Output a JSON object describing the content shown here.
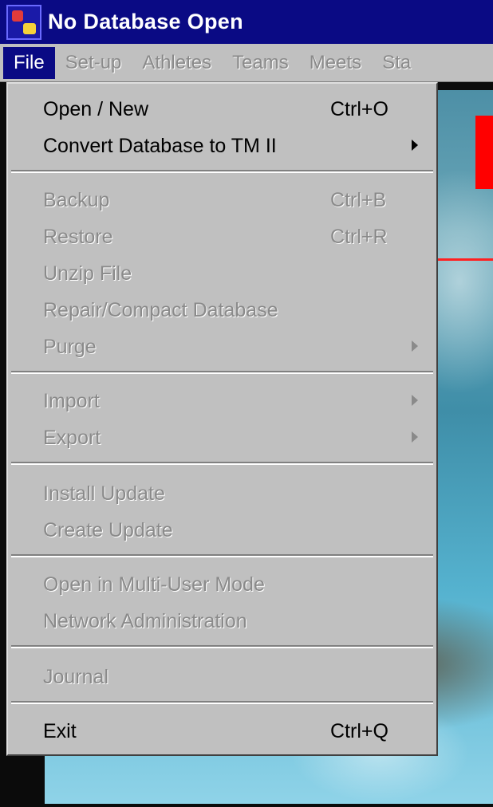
{
  "window": {
    "title": "No Database Open"
  },
  "menubar": {
    "items": [
      {
        "label": "File"
      },
      {
        "label": "Set-up"
      },
      {
        "label": "Athletes"
      },
      {
        "label": "Teams"
      },
      {
        "label": "Meets"
      },
      {
        "label": "Sta"
      }
    ]
  },
  "file_menu": {
    "items": [
      {
        "label": "Open / New",
        "shortcut": "Ctrl+O"
      },
      {
        "label": "Convert Database to TM II",
        "shortcut": ""
      },
      {
        "label": "Backup",
        "shortcut": "Ctrl+B"
      },
      {
        "label": "Restore",
        "shortcut": "Ctrl+R"
      },
      {
        "label": "Unzip File",
        "shortcut": ""
      },
      {
        "label": "Repair/Compact Database",
        "shortcut": ""
      },
      {
        "label": "Purge",
        "shortcut": ""
      },
      {
        "label": "Import",
        "shortcut": ""
      },
      {
        "label": "Export",
        "shortcut": ""
      },
      {
        "label": "Install Update",
        "shortcut": ""
      },
      {
        "label": "Create Update",
        "shortcut": ""
      },
      {
        "label": "Open in Multi-User Mode",
        "shortcut": ""
      },
      {
        "label": "Network Administration",
        "shortcut": ""
      },
      {
        "label": "Journal",
        "shortcut": ""
      },
      {
        "label": "Exit",
        "shortcut": "Ctrl+Q"
      }
    ]
  },
  "colors": {
    "titlebar": "#0a0a84",
    "menu_face": "#c0c0c0",
    "disabled_text": "#8a8a8a",
    "enabled_text": "#000000"
  }
}
